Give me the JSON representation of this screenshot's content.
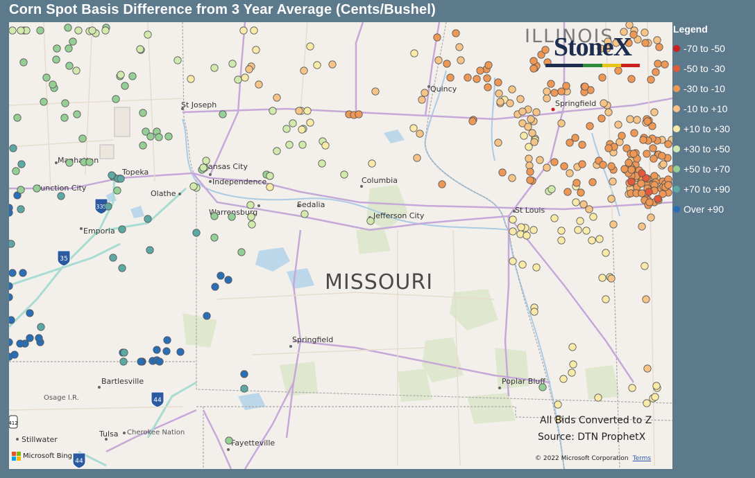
{
  "title": "Corn Spot Basis Difference from 3 Year Average (Cents/Bushel)",
  "legend": {
    "title": "Legend",
    "items": [
      {
        "label": "-70 to -50",
        "color": "#cc1f1f"
      },
      {
        "label": "-50 to -30",
        "color": "#e45a3a"
      },
      {
        "label": "-30 to -10",
        "color": "#ef9855"
      },
      {
        "label": "-10 to +10",
        "color": "#f6c487"
      },
      {
        "label": "+10 to +30",
        "color": "#faeaa8"
      },
      {
        "label": "+30 to +50",
        "color": "#d2e9ad"
      },
      {
        "label": "+50 to +70",
        "color": "#95cf95"
      },
      {
        "label": "+70 to +90",
        "color": "#5ea8a4"
      },
      {
        "label": "Over +90",
        "color": "#2a6fb5"
      }
    ]
  },
  "map": {
    "state_labels": {
      "missouri": "MISSOURI",
      "illinois": "ILLINOIS"
    },
    "cities": {
      "st_joseph": "St Joseph",
      "kansas_city": "Kansas City",
      "independence": "Independence",
      "topeka": "Topeka",
      "manhattan": "Manhattan",
      "junction_city": "Junction City",
      "olathe": "Olathe",
      "emporia": "Emporia",
      "warrensburg": "Warrensburg",
      "sedalia": "Sedalia",
      "columbia": "Columbia",
      "jefferson_city": "Jefferson City",
      "st_louis": "St Louis",
      "quincy": "Quincy",
      "springfield_il": "Springfield",
      "springfield_mo": "Springfield",
      "bartlesville": "Bartlesville",
      "osage": "Osage I.R.",
      "tulsa": "Tulsa",
      "cherokee": "Cherokee Nation",
      "stillwater": "Stillwater",
      "fayetteville": "Fayetteville",
      "poplar_bluff": "Poplar Bluff"
    },
    "shields": {
      "i335": "335",
      "i35": "35",
      "i44a": "44",
      "i44b": "44",
      "us412": "412"
    }
  },
  "logo": {
    "text": "StoneX",
    "bar_colors": [
      "#1c2d4f",
      "#1c2d4f",
      "#2e8b3a",
      "#e8c51c",
      "#cc1f1f"
    ]
  },
  "notes": {
    "converted": "All Bids Converted to Z",
    "source": "Source: DTN ProphetX"
  },
  "attribution": {
    "bing": "Microsoft Bing",
    "copyright": "© 2022 Microsoft Corporation",
    "terms": "Terms",
    "bing_colors": [
      "#f25022",
      "#7fba00",
      "#00a4ef",
      "#ffb900"
    ]
  }
}
